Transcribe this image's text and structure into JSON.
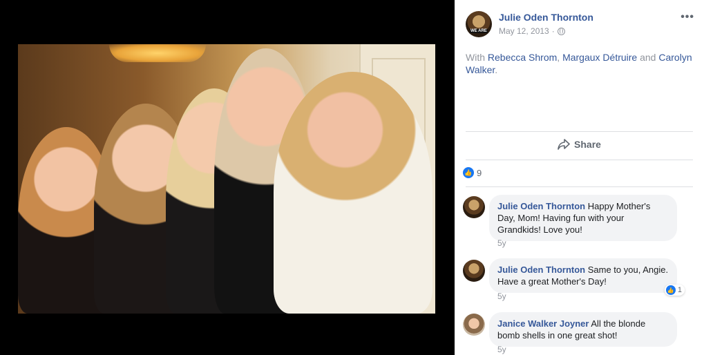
{
  "post": {
    "author": "Julie Oden Thornton",
    "date": "May 12, 2013",
    "date_separator": "·",
    "privacy_icon": "globe-icon",
    "more_label": "•••",
    "with_prefix": "With",
    "tagged": [
      "Rebecca Shrom",
      "Margaux Détruire",
      "Carolyn Walker"
    ],
    "comma": ",",
    "and_word": "and",
    "period": "."
  },
  "actions": {
    "share_label": "Share"
  },
  "reactions": {
    "like_count": "9"
  },
  "comments": [
    {
      "author": "Julie Oden Thornton",
      "text_lines": [
        "Happy Mother's Day,",
        "Mom! Having fun with your Grandkids! Love",
        "you!"
      ],
      "time": "5y",
      "likes": ""
    },
    {
      "author": "Julie Oden Thornton",
      "text_lines": [
        "Same to you, Angie.",
        "Have a great Mother's Day!"
      ],
      "time": "5y",
      "likes": "1"
    },
    {
      "author": "Janice Walker Joyner",
      "text_lines": [
        "All the blonde bomb",
        "shells in one great shot!"
      ],
      "time": "5y",
      "likes": ""
    }
  ],
  "colors": {
    "link": "#365899",
    "muted": "#90949c",
    "like_blue": "#1877f2"
  }
}
